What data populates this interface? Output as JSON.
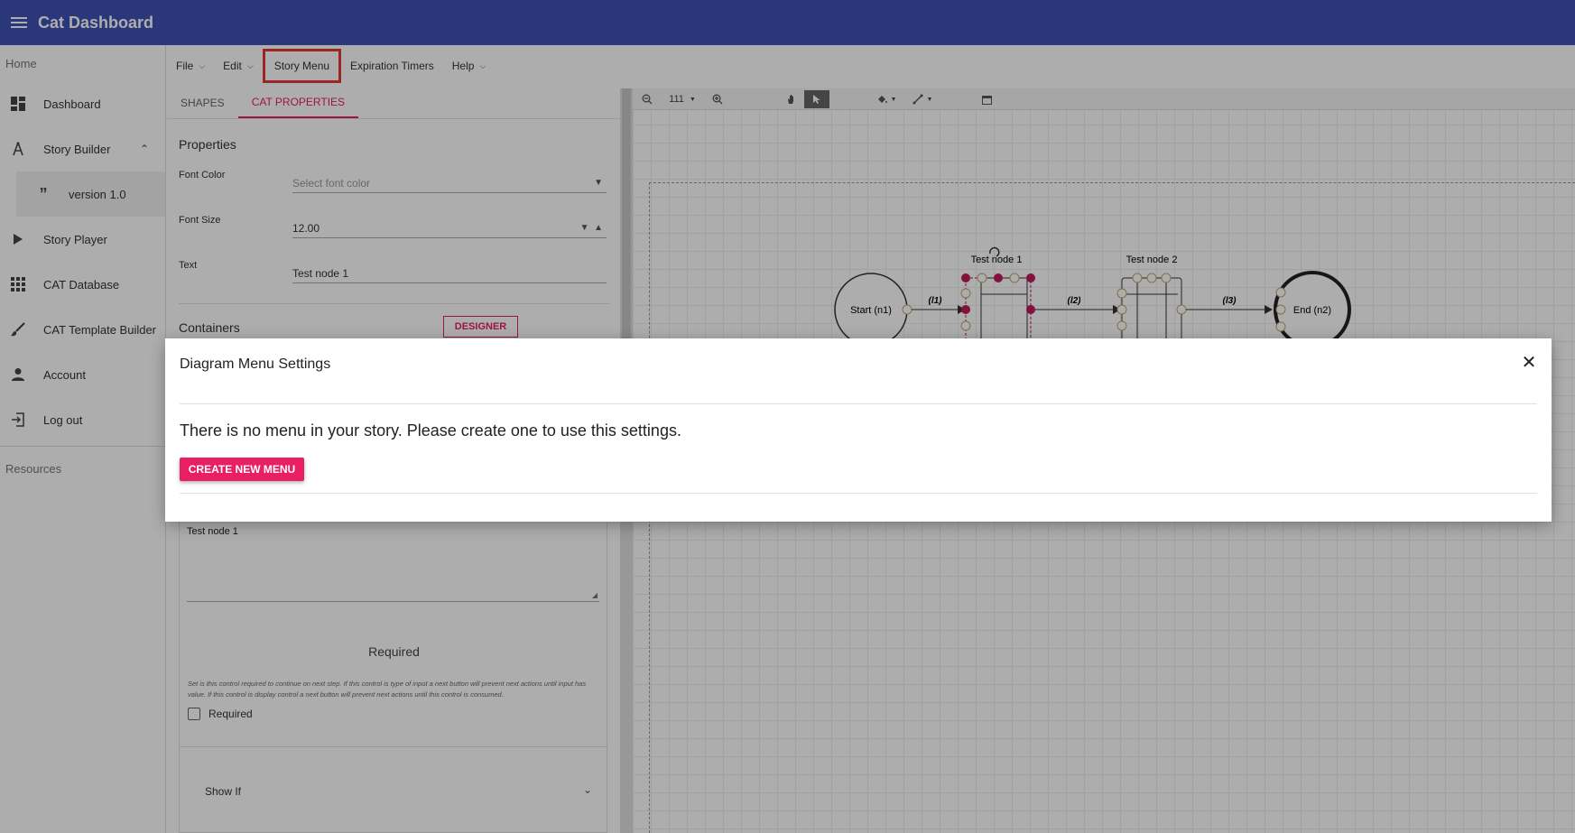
{
  "app": {
    "title": "Cat Dashboard"
  },
  "sidebar": {
    "home_label": "Home",
    "items": [
      {
        "label": "Dashboard",
        "icon": "dashboard-icon"
      },
      {
        "label": "Story Builder",
        "icon": "compass-icon"
      },
      {
        "label": "version 1.0",
        "icon": "quote-icon"
      },
      {
        "label": "Story Player",
        "icon": "play-icon"
      },
      {
        "label": "CAT Database",
        "icon": "grid-icon"
      },
      {
        "label": "CAT Template Builder",
        "icon": "brush-icon"
      },
      {
        "label": "Account",
        "icon": "person-icon"
      },
      {
        "label": "Log out",
        "icon": "logout-icon"
      }
    ],
    "resources_label": "Resources"
  },
  "menubar": {
    "items": [
      "File",
      "Edit",
      "Story Menu",
      "Expiration Timers",
      "Help"
    ]
  },
  "panel": {
    "tabs": [
      "SHAPES",
      "CAT PROPERTIES"
    ],
    "properties_heading": "Properties",
    "font_color": {
      "label": "Font Color",
      "placeholder": "Select font color"
    },
    "font_size": {
      "label": "Font Size",
      "value": "12.00"
    },
    "text": {
      "label": "Text",
      "value": "Test node 1"
    },
    "containers_label": "Containers",
    "designer_label": "DESIGNER",
    "textarea_value": "Test node 1",
    "required_title": "Required",
    "required_desc": "Set is this control required to continue on next step. If this control is type of input a next button will prevent next actions until input has value. If this control is display control a next button will prevent next actions until this control is consumed.",
    "required_checkbox_label": "Required",
    "show_if_label": "Show If"
  },
  "canvas": {
    "zoom": "111",
    "nodes": [
      {
        "label": "Start (n1)"
      },
      {
        "label": "Test node 1"
      },
      {
        "label": "Test node 2"
      },
      {
        "label": "End (n2)"
      }
    ],
    "links": [
      "(l1)",
      "(l2)",
      "(l3)"
    ],
    "colors": {
      "selected": "#c2185b",
      "port": "#d4c08a"
    }
  },
  "modal": {
    "title": "Diagram Menu Settings",
    "message": "There is no menu in your story. Please create one to use this settings.",
    "button_label": "CREATE NEW MENU"
  }
}
